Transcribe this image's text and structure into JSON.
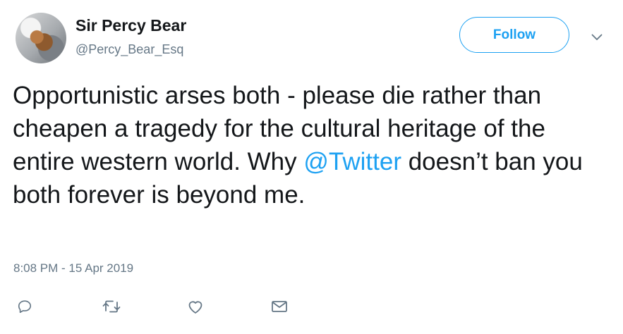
{
  "user": {
    "display_name": "Sir Percy Bear",
    "handle": "@Percy_Bear_Esq"
  },
  "follow_label": "Follow",
  "tweet": {
    "text_before_mention": "Opportunistic arses both - please die rather than cheapen a tragedy for the cultural heritage of the entire western world. Why ",
    "mention": "@Twitter",
    "text_after_mention": " doesn’t ban you both forever is beyond me."
  },
  "timestamp": "8:08 PM - 15 Apr 2019",
  "icons": {
    "caret": "chevron-down-icon",
    "reply": "reply-icon",
    "retweet": "retweet-icon",
    "like": "heart-icon",
    "dm": "envelope-icon"
  },
  "colors": {
    "accent": "#1da1f2",
    "text": "#14171a",
    "secondary": "#657786"
  }
}
